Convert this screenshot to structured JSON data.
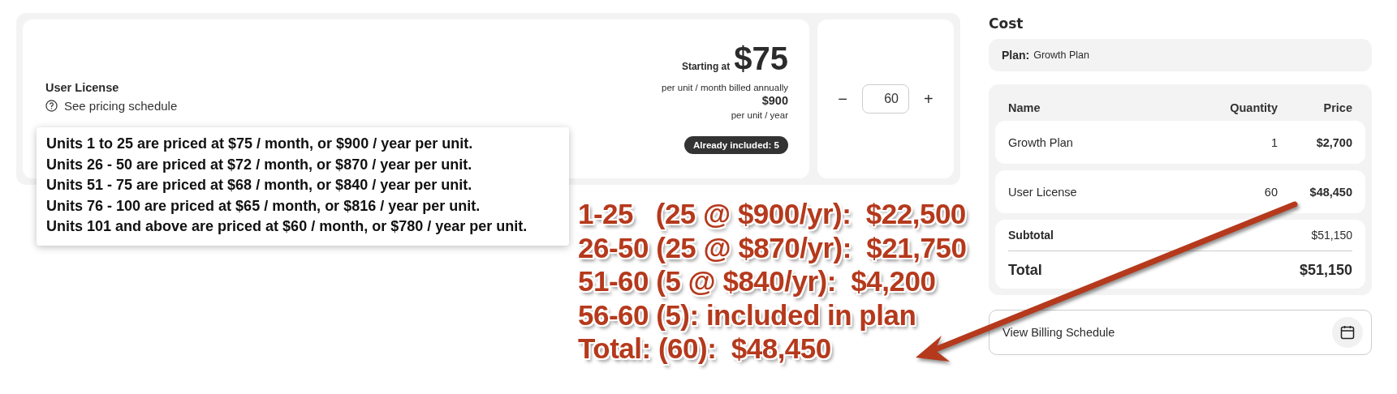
{
  "product": {
    "name": "User License",
    "pricing_link": "See pricing schedule",
    "starting_label": "Starting at",
    "starting_price": "$75",
    "monthly_note": "per unit / month billed annually",
    "annual_price": "$900",
    "annual_note": "per unit / year",
    "included_badge": "Already included: 5"
  },
  "quantity": {
    "decrement": "−",
    "value": "60",
    "increment": "+"
  },
  "pricing_tooltip": [
    "Units 1 to 25 are priced at $75 / month, or $900 / year per unit.",
    "Units 26 - 50 are priced at $72 / month, or $870 / year per unit.",
    "Units 51 - 75 are priced at $68 / month, or $840 / year per unit.",
    "Units 76 - 100 are priced at $65 / month, or $816 / year per unit.",
    "Units 101 and above are priced at $60 / month, or $780 / year per unit."
  ],
  "cost": {
    "title": "Cost",
    "plan": {
      "label": "Plan:",
      "value": "Growth Plan"
    },
    "columns": [
      "Name",
      "Quantity",
      "Price"
    ],
    "rows": [
      {
        "name": "Growth Plan",
        "quantity": "1",
        "price": "$2,700"
      },
      {
        "name": "User License",
        "quantity": "60",
        "price": "$48,450"
      }
    ],
    "subtotal_label": "Subtotal",
    "subtotal": "$51,150",
    "total_label": "Total",
    "total": "$51,150",
    "billing_button": "View Billing Schedule"
  },
  "annotation": [
    "1-25   (25 @ $900/yr):  $22,500",
    "26-50 (25 @ $870/yr):  $21,750",
    "51-60 (5 @ $840/yr):  $4,200",
    "56-60 (5): included in plan",
    "Total: (60):  $48,450"
  ]
}
